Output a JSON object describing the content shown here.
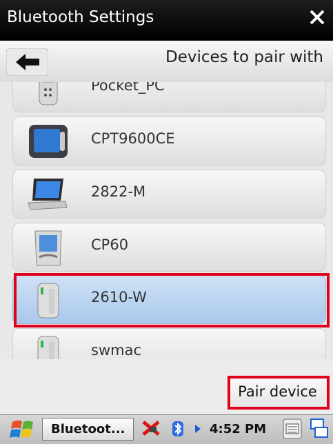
{
  "window": {
    "title": "Bluetooth Settings"
  },
  "header": {
    "title": "Devices to pair with"
  },
  "devices": [
    {
      "name": "Pocket_PC",
      "icon": "pocket-pc-icon"
    },
    {
      "name": "CPT9600CE",
      "icon": "tablet-terminal-icon"
    },
    {
      "name": "2822-M",
      "icon": "laptop-icon"
    },
    {
      "name": "CP60",
      "icon": "pda-icon"
    },
    {
      "name": "2610-W",
      "icon": "access-point-icon",
      "selected": true
    },
    {
      "name": "swmac",
      "icon": "access-point-icon"
    }
  ],
  "actions": {
    "pair_device": "Pair device"
  },
  "taskbar": {
    "active_task": "Bluetoot...",
    "time": "4:52 PM"
  },
  "colors": {
    "highlight": "#e0001b",
    "selected_row": "#b9d2ef"
  }
}
